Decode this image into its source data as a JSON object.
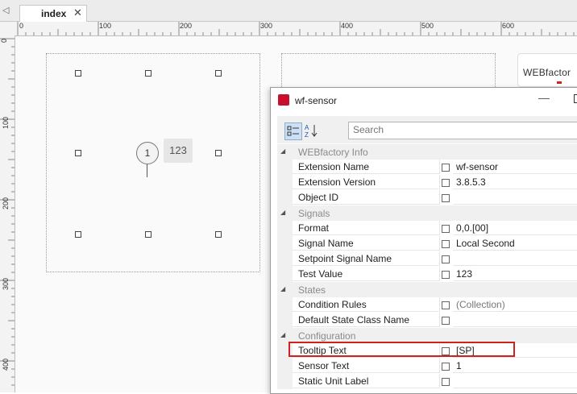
{
  "tab": {
    "label": "index",
    "close_glyph": "✕",
    "scroll_glyph": "◁"
  },
  "ruler": {
    "top_labels": [
      "0",
      "100",
      "200",
      "300",
      "400",
      "500",
      "600"
    ],
    "left_labels": [
      "0",
      "100",
      "200",
      "300",
      "400"
    ]
  },
  "canvas": {
    "sensor_number": "1",
    "sensor_value": "123",
    "logo_text": "WEBfactor"
  },
  "properties_window": {
    "title": "wf-sensor",
    "search_placeholder": "Search",
    "categories": [
      {
        "label": "WEBfactory Info",
        "rows": [
          {
            "name": "Extension Name",
            "value": "wf-sensor"
          },
          {
            "name": "Extension Version",
            "value": "3.8.5.3"
          },
          {
            "name": "Object ID",
            "value": ""
          }
        ]
      },
      {
        "label": "Signals",
        "rows": [
          {
            "name": "Format",
            "value": "0,0.[00]"
          },
          {
            "name": "Signal Name",
            "value": "Local Second"
          },
          {
            "name": "Setpoint Signal Name",
            "value": ""
          },
          {
            "name": "Test Value",
            "value": "123"
          }
        ]
      },
      {
        "label": "States",
        "rows": [
          {
            "name": "Condition Rules",
            "value": "(Collection)"
          },
          {
            "name": "Default State Class Name",
            "value": ""
          }
        ]
      },
      {
        "label": "Configuration",
        "rows": [
          {
            "name": "Tooltip Text",
            "value": "[SP]"
          },
          {
            "name": "Sensor Text",
            "value": "1"
          },
          {
            "name": "Static Unit Label",
            "value": ""
          }
        ]
      }
    ]
  },
  "colors": {
    "accent_red": "#d02020",
    "app_icon": "#c8102e",
    "category_bg": "#f0f0f0"
  }
}
